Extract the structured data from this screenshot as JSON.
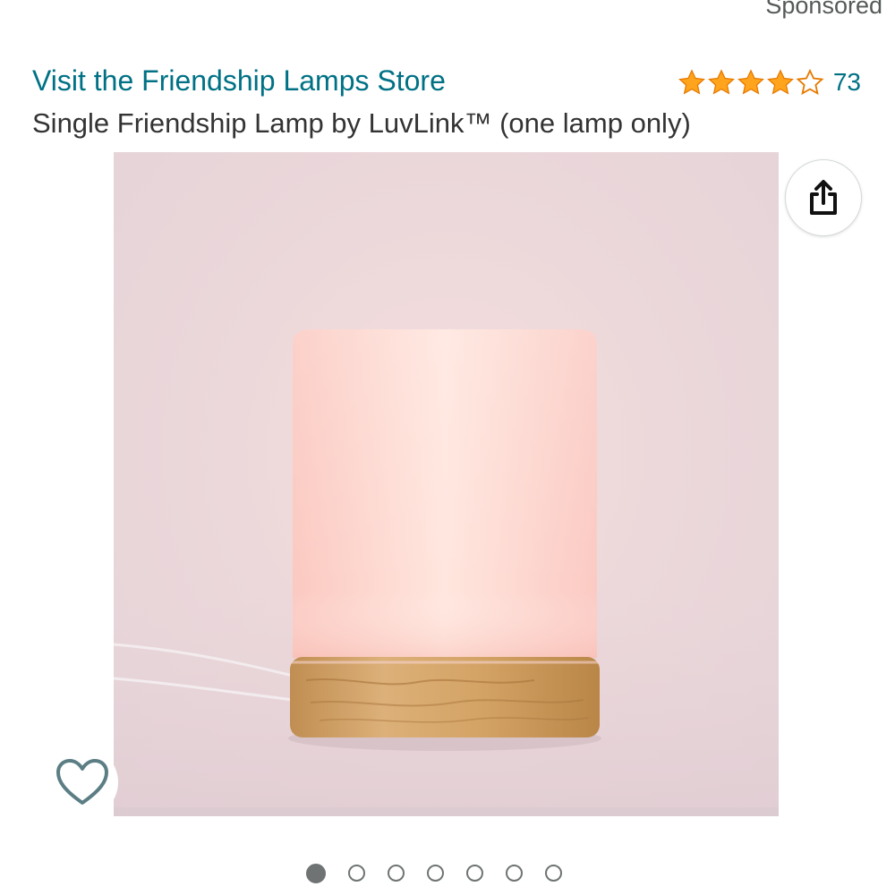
{
  "header": {
    "sponsored_label": "Sponsored"
  },
  "store": {
    "link_text": "Visit the Friendship Lamps Store",
    "color": "#007185"
  },
  "rating": {
    "stars": 4.5,
    "max_stars": 5,
    "review_count": "73",
    "star_color": "#FFA41C"
  },
  "product": {
    "title": "Single Friendship Lamp by LuvLink™ (one lamp only)"
  },
  "image": {
    "icons": {
      "share": "share-icon",
      "wishlist": "heart-icon"
    }
  },
  "carousel": {
    "total": 7,
    "active_index": 0
  }
}
